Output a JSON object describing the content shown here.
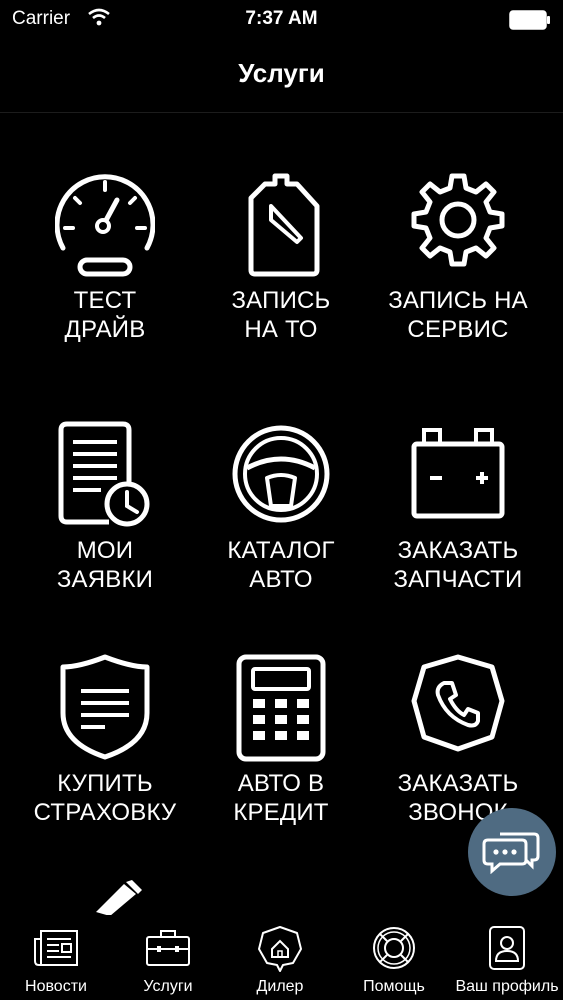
{
  "status_bar": {
    "carrier": "Carrier",
    "time": "7:37 AM"
  },
  "header": {
    "title": "Услуги"
  },
  "services": [
    {
      "line1": "ТЕСТ",
      "line2": "ДРАЙВ",
      "icon": "speedometer-icon"
    },
    {
      "line1": "ЗАПИСЬ",
      "line2": "НА ТО",
      "icon": "oil-canister-icon"
    },
    {
      "line1": "ЗАПИСЬ НА",
      "line2": "СЕРВИС",
      "icon": "gear-icon"
    },
    {
      "line1": "МОИ",
      "line2": "ЗАЯВКИ",
      "icon": "document-clock-icon"
    },
    {
      "line1": "КАТАЛОГ",
      "line2": "АВТО",
      "icon": "steering-wheel-icon"
    },
    {
      "line1": "ЗАКАЗАТЬ",
      "line2": "ЗАПЧАСТИ",
      "icon": "battery-icon"
    },
    {
      "line1": "КУПИТЬ",
      "line2": "СТРАХОВКУ",
      "icon": "shield-icon"
    },
    {
      "line1": "АВТО В",
      "line2": "КРЕДИТ",
      "icon": "calculator-icon"
    },
    {
      "line1": "ЗАКАЗАТЬ",
      "line2": "ЗВОНОК",
      "icon": "phone-icon"
    }
  ],
  "tab_bar": {
    "items": [
      {
        "label": "Новости",
        "icon": "newspaper-icon"
      },
      {
        "label": "Услуги",
        "icon": "briefcase-icon"
      },
      {
        "label": "Дилер",
        "icon": "dealer-home-icon"
      },
      {
        "label": "Помощь",
        "icon": "lifebuoy-icon"
      },
      {
        "label": "Ваш профиль",
        "icon": "profile-icon"
      }
    ]
  },
  "colors": {
    "background": "#000000",
    "foreground": "#ffffff",
    "chat_fab": "#4f6b82"
  }
}
